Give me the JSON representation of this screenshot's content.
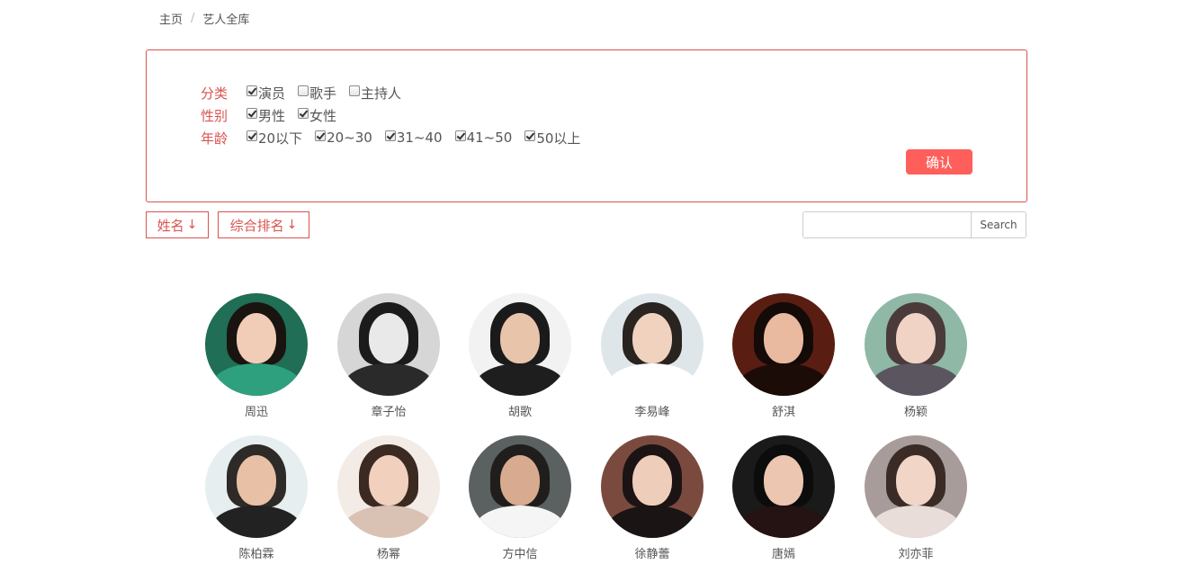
{
  "breadcrumb": {
    "home": "主页",
    "separator": "/",
    "current": "艺人全库"
  },
  "filters": {
    "category": {
      "label": "分类",
      "options": [
        {
          "label": "演员",
          "checked": true
        },
        {
          "label": "歌手",
          "checked": false
        },
        {
          "label": "主持人",
          "checked": false
        }
      ]
    },
    "gender": {
      "label": "性别",
      "options": [
        {
          "label": "男性",
          "checked": true
        },
        {
          "label": "女性",
          "checked": true
        }
      ]
    },
    "age": {
      "label": "年龄",
      "options": [
        {
          "label": "20以下",
          "checked": true
        },
        {
          "label": "20~30",
          "checked": true
        },
        {
          "label": "31~40",
          "checked": true
        },
        {
          "label": "41~50",
          "checked": true
        },
        {
          "label": "50以上",
          "checked": true
        }
      ]
    },
    "confirm_label": "确认"
  },
  "sort": {
    "name_label": "姓名",
    "rank_label": "综合排名",
    "arrow": "↓"
  },
  "search": {
    "value": "",
    "button_label": "Search"
  },
  "colors": {
    "accent": "#d9534f",
    "confirm_bg": "#ff5f5a"
  },
  "artists": [
    {
      "name": "周迅",
      "palette": [
        "#1f6e55",
        "#1a1410",
        "#f1cdb7",
        "#2fa07d"
      ]
    },
    {
      "name": "章子怡",
      "palette": [
        "#d6d6d6",
        "#1b1b1b",
        "#e9e9e9",
        "#2a2a2a"
      ]
    },
    {
      "name": "胡歌",
      "palette": [
        "#f2f2f2",
        "#1a1a1a",
        "#e8c4aa",
        "#1e1e1e"
      ]
    },
    {
      "name": "李易峰",
      "palette": [
        "#dfe6ea",
        "#2a2420",
        "#f0d2bf",
        "#ffffff"
      ]
    },
    {
      "name": "舒淇",
      "palette": [
        "#5a1d12",
        "#140a08",
        "#e9b9a0",
        "#1c0c08"
      ]
    },
    {
      "name": "杨颖",
      "palette": [
        "#8fb8a6",
        "#4a3b3a",
        "#f1d3c5",
        "#5b5560"
      ]
    },
    {
      "name": "陈柏霖",
      "palette": [
        "#e6eef0",
        "#2d2a28",
        "#e7c0a6",
        "#222222"
      ]
    },
    {
      "name": "杨幂",
      "palette": [
        "#f3ece6",
        "#3a2a22",
        "#f1d0bd",
        "#d9c2b4"
      ]
    },
    {
      "name": "方中信",
      "palette": [
        "#5b6160",
        "#1f1e1c",
        "#d8ab90",
        "#f5f5f5"
      ]
    },
    {
      "name": "徐静蕾",
      "palette": [
        "#7b4a3e",
        "#1c1414",
        "#efcdbb",
        "#1a1414"
      ]
    },
    {
      "name": "唐嫣",
      "palette": [
        "#1a1a1a",
        "#0c0c0c",
        "#ecc6b0",
        "#251212"
      ]
    },
    {
      "name": "刘亦菲",
      "palette": [
        "#a79c9a",
        "#3a2b26",
        "#f1d6c8",
        "#e8ddd8"
      ]
    }
  ]
}
